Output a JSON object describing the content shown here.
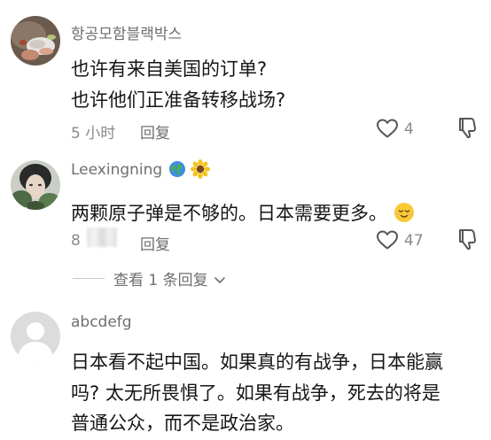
{
  "comments": [
    {
      "username": "항공모함블랙박스",
      "lines": [
        "也许有来自美国的订单?",
        "也许他们正准备转移战场?"
      ],
      "time": "5 小时",
      "reply_label": "回复",
      "likes": "4"
    },
    {
      "username": "Leexingning",
      "username_icons": [
        "globe-icon",
        "sunflower-icon"
      ],
      "lines": [
        "两颗原子弹是不够的。日本需要更多。"
      ],
      "line_emoji": "relieved-face-emoji",
      "time": "8",
      "reply_label": "回复",
      "likes": "47",
      "view_replies_label": "查看 1 条回复"
    },
    {
      "username": "abcdefg",
      "lines": [
        "日本看不起中国。如果真的有战争，日本能赢",
        "吗? 太无所畏惧了。如果有战争，死去的将是",
        "普通公众，而不是政治家。"
      ]
    }
  ]
}
